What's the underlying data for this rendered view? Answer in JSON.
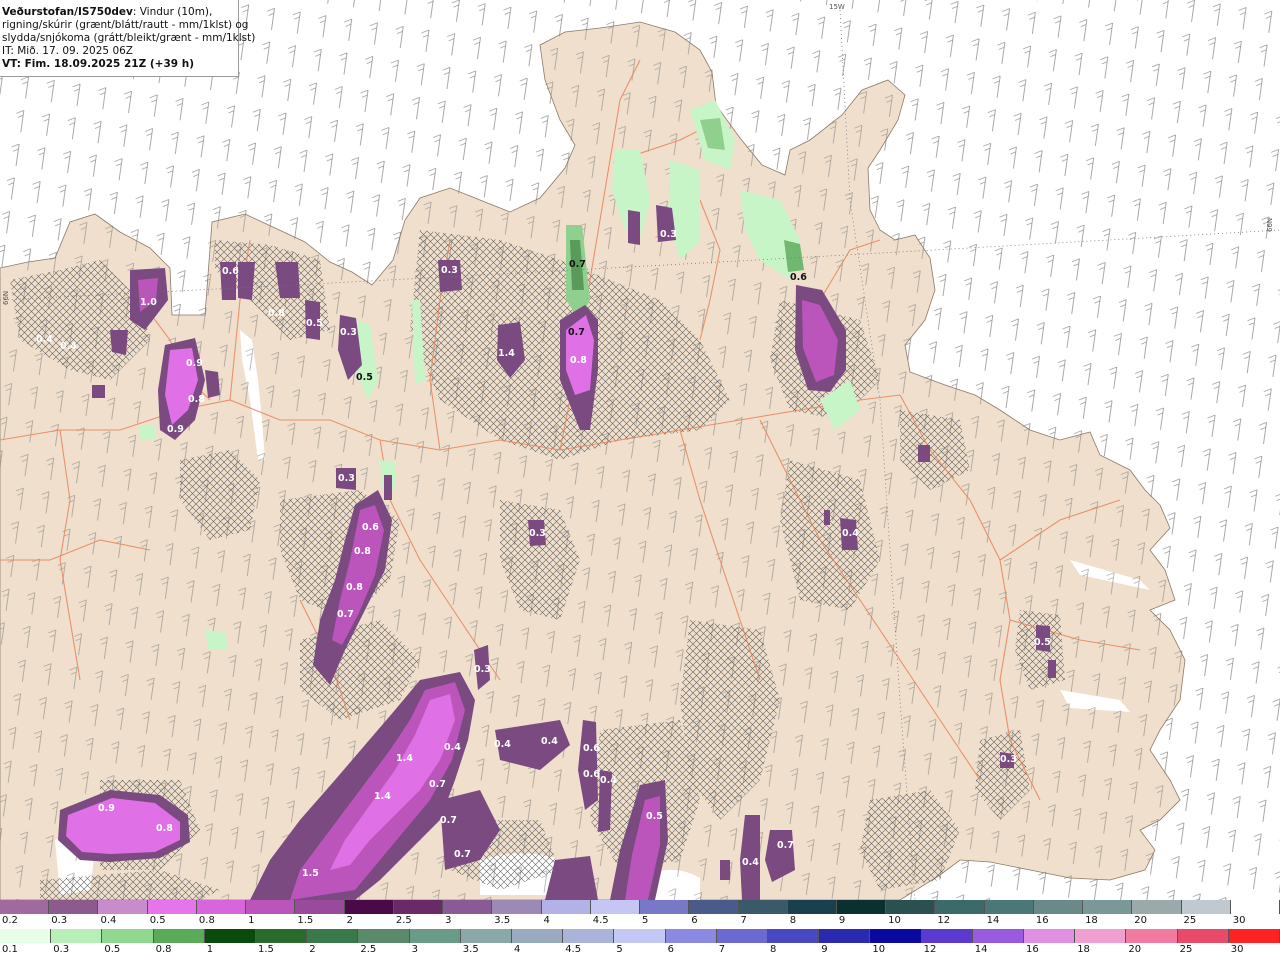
{
  "header": {
    "source": "Veðurstofan/IS750dev",
    "desc1": ": Vindur (10m),",
    "desc2": "rigning/skúrir (grænt/blátt/rautt - mm/1klst) og",
    "desc3": "slydda/snjókoma (grátt/bleikt/grænt - mm/1klst)",
    "issue": "IT: Mið. 17. 09. 2025 06Z",
    "valid": "VT: Fim. 18.09.2025 21Z (+39 h)"
  },
  "grid_labels": {
    "top_lon": "15W",
    "right_lat": "66N",
    "left_lat": "66N"
  },
  "colors": {
    "sea": "#ffffff",
    "land": "#efdfcc",
    "roads": "#e8845a",
    "pink": "#e070e6",
    "magenta": "#cc55cc",
    "dark_purple": "#7a4a80",
    "light_green": "#c8f5c8",
    "mid_green": "#6fb86f"
  },
  "map_labels": {
    "snow_values": [
      "0.7",
      "0.7",
      "0.6",
      "0.5",
      "0.3",
      "0.4",
      "0.8",
      "1.4",
      "0.8",
      "0.4",
      "0.9",
      "1.0",
      "0.8",
      "0.9",
      "0.6",
      "0.8",
      "0.8",
      "0.7",
      "0.3",
      "0.3",
      "0.4",
      "0.4",
      "0.5",
      "0.3",
      "1.4",
      "1.4",
      "0.7",
      "0.7",
      "0.7",
      "1.5",
      "0.9",
      "0.8",
      "0.4",
      "0.4",
      "0.6",
      "0.6",
      "0.4",
      "0.5",
      "0.4",
      "0.7",
      "0.3",
      "0.6",
      "0.5",
      "0.3",
      "0.3"
    ]
  },
  "legend_snow": {
    "labels": [
      "0.2",
      "0.3",
      "0.4",
      "0.5",
      "0.8",
      "1",
      "1.5",
      "2",
      "2.5",
      "3",
      "3.5",
      "4",
      "4.5",
      "5",
      "6",
      "7",
      "8",
      "9",
      "10",
      "12",
      "14",
      "16",
      "18",
      "20",
      "25",
      "30"
    ],
    "colors": [
      "#a06a9e",
      "#8c5a8c",
      "#c88ccc",
      "#e674ea",
      "#d766dd",
      "#bb55bb",
      "#9a4a9c",
      "#4a0a4a",
      "#6a2a6a",
      "#8a5a96",
      "#9c8ab4",
      "#b2b2e8",
      "#c6c6f4",
      "#7878c8",
      "#4a5a8a",
      "#3a5a6a",
      "#1a4050",
      "#0a3030",
      "#2a5050",
      "#3a6a6a",
      "#4a7878",
      "#6a8a8a",
      "#7a9898",
      "#9aaaaa",
      "#c0c8d0",
      "#ffffff"
    ]
  },
  "legend_rain": {
    "labels": [
      "0.1",
      "0.3",
      "0.5",
      "0.8",
      "1",
      "1.5",
      "2",
      "2.5",
      "3",
      "3.5",
      "4",
      "4.5",
      "5",
      "6",
      "7",
      "8",
      "9",
      "10",
      "12",
      "14",
      "16",
      "18",
      "20",
      "25",
      "30"
    ],
    "colors": [
      "#e6ffe6",
      "#b8eeb8",
      "#90d890",
      "#5aaa5a",
      "#0a4a0a",
      "#2a6a2a",
      "#3a7a4a",
      "#5a8a6a",
      "#6a9a88",
      "#8aa8a8",
      "#9aaac0",
      "#aab4d8",
      "#c4c8f4",
      "#8a8ae0",
      "#6a6ad0",
      "#4848c0",
      "#2a2ab0",
      "#0a0aa0",
      "#5a3ad0",
      "#9a5ae0",
      "#e090e0",
      "#f0a0d0",
      "#f07aa0",
      "#e84a6a",
      "#ff2222"
    ]
  }
}
